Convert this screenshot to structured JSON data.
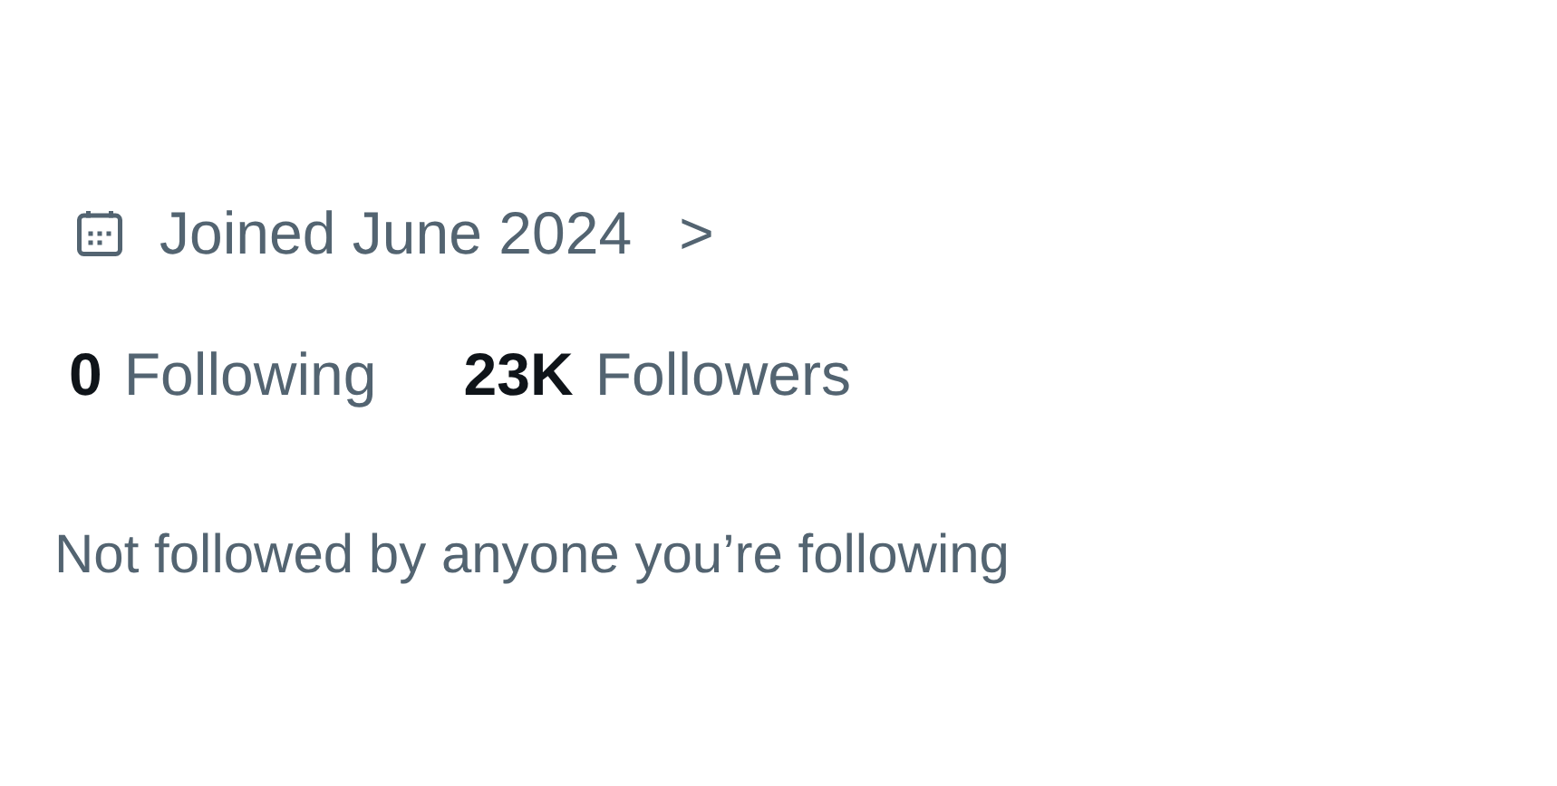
{
  "joined": {
    "text": "Joined June 2024",
    "chevron": ">"
  },
  "stats": [
    {
      "count": "0",
      "label": "Following"
    },
    {
      "count": "23K",
      "label": "Followers"
    }
  ],
  "followed_by": "Not followed by anyone you’re following"
}
